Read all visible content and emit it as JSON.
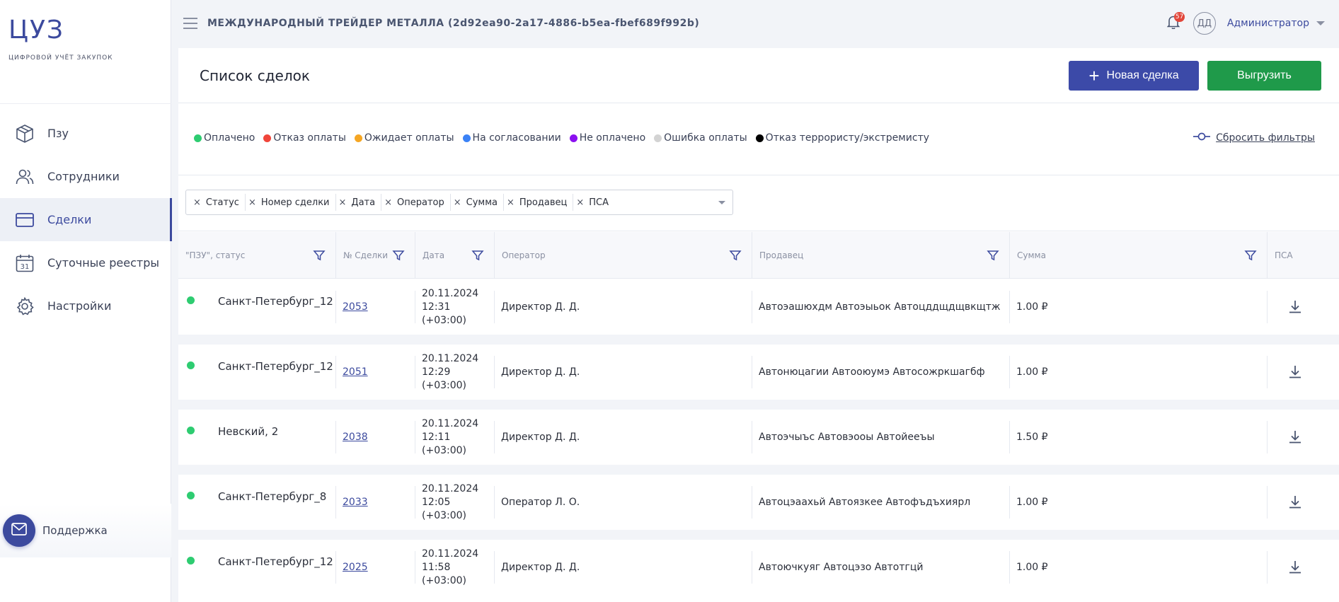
{
  "logo": {
    "title": "ЦУЗ",
    "subtitle": "ЦИФРОВОЙ УЧЁТ ЗАКУПОК"
  },
  "sidebar": {
    "items": [
      {
        "label": "Пзу",
        "icon": "box-icon"
      },
      {
        "label": "Сотрудники",
        "icon": "users-icon"
      },
      {
        "label": "Сделки",
        "icon": "card-icon",
        "active": true
      },
      {
        "label": "Суточные реестры",
        "icon": "calendar-icon"
      },
      {
        "label": "Настройки",
        "icon": "gear-icon"
      }
    ],
    "calendar_day": "31",
    "support_label": "Поддержка"
  },
  "header": {
    "org_title": "МЕЖДУНАРОДНЫЙ ТРЕЙДЕР МЕТАЛЛА (2d92ea90-2a17-4886-b5ea-fbef689f992b)",
    "notifications": "57",
    "avatar_initials": "ДД",
    "user_name": "Администратор"
  },
  "page": {
    "title": "Список сделок",
    "new_deal_label": "Новая сделка",
    "export_label": "Выгрузить",
    "reset_filters_label": "Сбросить фильтры"
  },
  "legend": [
    {
      "label": "Оплачено",
      "color": "#2ecc71"
    },
    {
      "label": "Отказ оплаты",
      "color": "#f0453a"
    },
    {
      "label": "Ожидает оплаты",
      "color": "#f5a623"
    },
    {
      "label": "На согласовании",
      "color": "#3b82f6"
    },
    {
      "label": "Не оплачено",
      "color": "#8b10f0"
    },
    {
      "label": "Ошибка оплаты",
      "color": "#d3d3d3"
    },
    {
      "label": "Отказ террористу/экстремисту",
      "color": "#000000"
    }
  ],
  "columns_chips": [
    "Статус",
    "Номер сделки",
    "Дата",
    "Оператор",
    "Сумма",
    "Продавец",
    "ПСА"
  ],
  "table": {
    "headers": {
      "pzu": "\"ПЗУ\", статус",
      "deal": "№ Сделки",
      "date": "Дата",
      "operator": "Оператор",
      "seller": "Продавец",
      "sum": "Сумма",
      "psa": "ПСА"
    },
    "rows": [
      {
        "pzu": "Санкт-Петербург_12",
        "deal": "2053",
        "date": "20.11.2024",
        "time": "12:31",
        "tz": "(+03:00)",
        "operator": "Директор Д. Д.",
        "seller": "Автоэашюхдм Автоэыьок Автоцддщдщвкщтж",
        "sum": "1.00 ₽",
        "status_color": "#2ecc71"
      },
      {
        "pzu": "Санкт-Петербург_12",
        "deal": "2051",
        "date": "20.11.2024",
        "time": "12:29",
        "tz": "(+03:00)",
        "operator": "Директор Д. Д.",
        "seller": "Автонюцагии Автооюумэ Автосожркшагбф",
        "sum": "1.00 ₽",
        "status_color": "#2ecc71"
      },
      {
        "pzu": "Невский, 2",
        "deal": "2038",
        "date": "20.11.2024",
        "time": "12:11",
        "tz": "(+03:00)",
        "operator": "Директор Д. Д.",
        "seller": "Автоэчыъс Автовэооы Автойееъы",
        "sum": "1.50 ₽",
        "status_color": "#2ecc71"
      },
      {
        "pzu": "Санкт-Петербург_8",
        "deal": "2033",
        "date": "20.11.2024",
        "time": "12:05",
        "tz": "(+03:00)",
        "operator": "Оператор Л. О.",
        "seller": "Автоцэаахьй Автоязкее Автофъдъхиярл",
        "sum": "1.00 ₽",
        "status_color": "#2ecc71"
      },
      {
        "pzu": "Санкт-Петербург_12",
        "deal": "2025",
        "date": "20.11.2024",
        "time": "11:58",
        "tz": "(+03:00)",
        "operator": "Директор Д. Д.",
        "seller": "Автоючкуяг Автоцэзо Автотгцй",
        "sum": "1.00 ₽",
        "status_color": "#2ecc71"
      }
    ]
  }
}
